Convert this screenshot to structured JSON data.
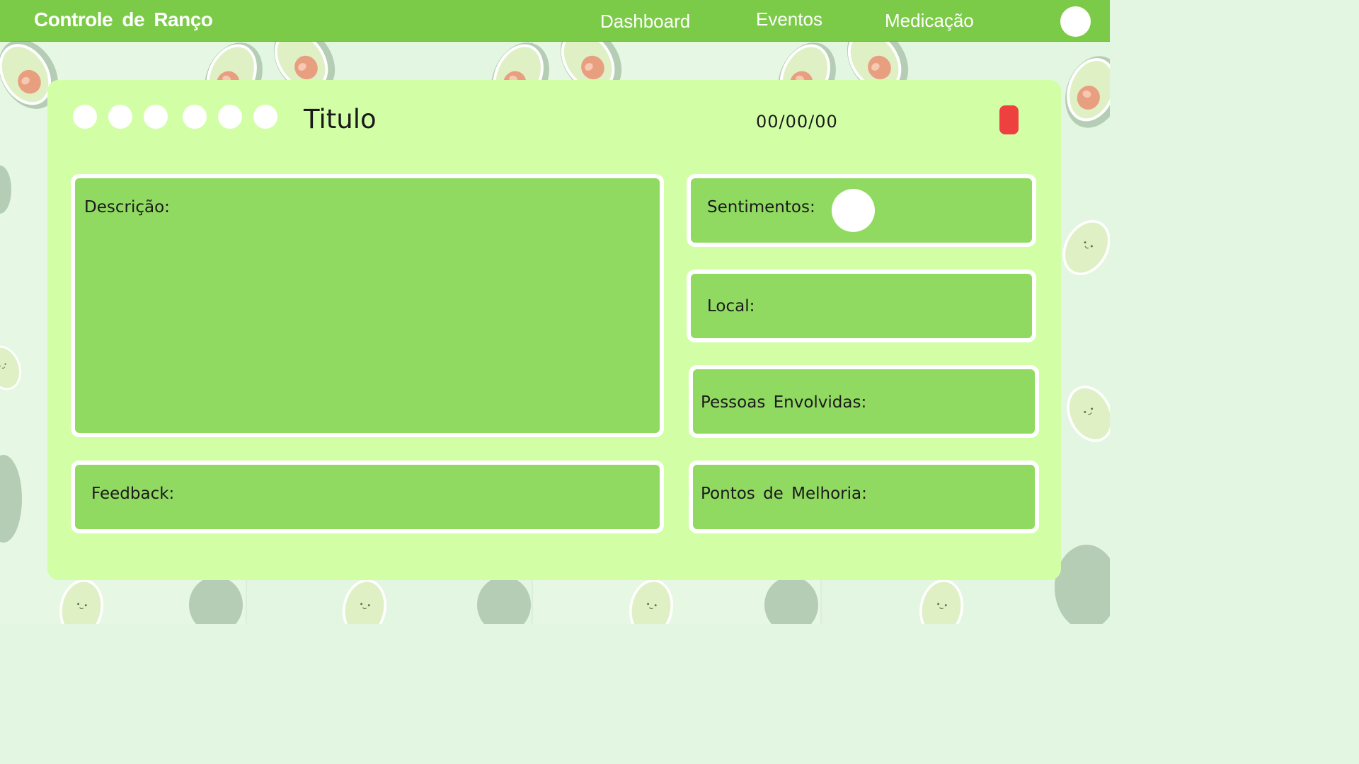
{
  "header": {
    "app_title": "Controle de Ranço",
    "nav": [
      "Dashboard",
      "Eventos",
      "Medicação"
    ]
  },
  "event": {
    "title": "Titulo",
    "date": "00/00/00",
    "rating_dots": 6
  },
  "fields": {
    "descricao": "Descrição:",
    "sentimentos": "Sentimentos:",
    "local": "Local:",
    "pessoas": "Pessoas Envolvidas:",
    "feedback": "Feedback:",
    "pontos": "Pontos de Melhoria:"
  },
  "colors": {
    "header_bg": "#7ccb48",
    "card_bg": "#d2ffa6",
    "field_bg": "#91da62",
    "delete": "#ef4040",
    "page_bg": "#e2f6e1"
  },
  "icons": [
    "avatar-icon",
    "delete-icon",
    "mood-icon",
    "avocado-pattern"
  ]
}
